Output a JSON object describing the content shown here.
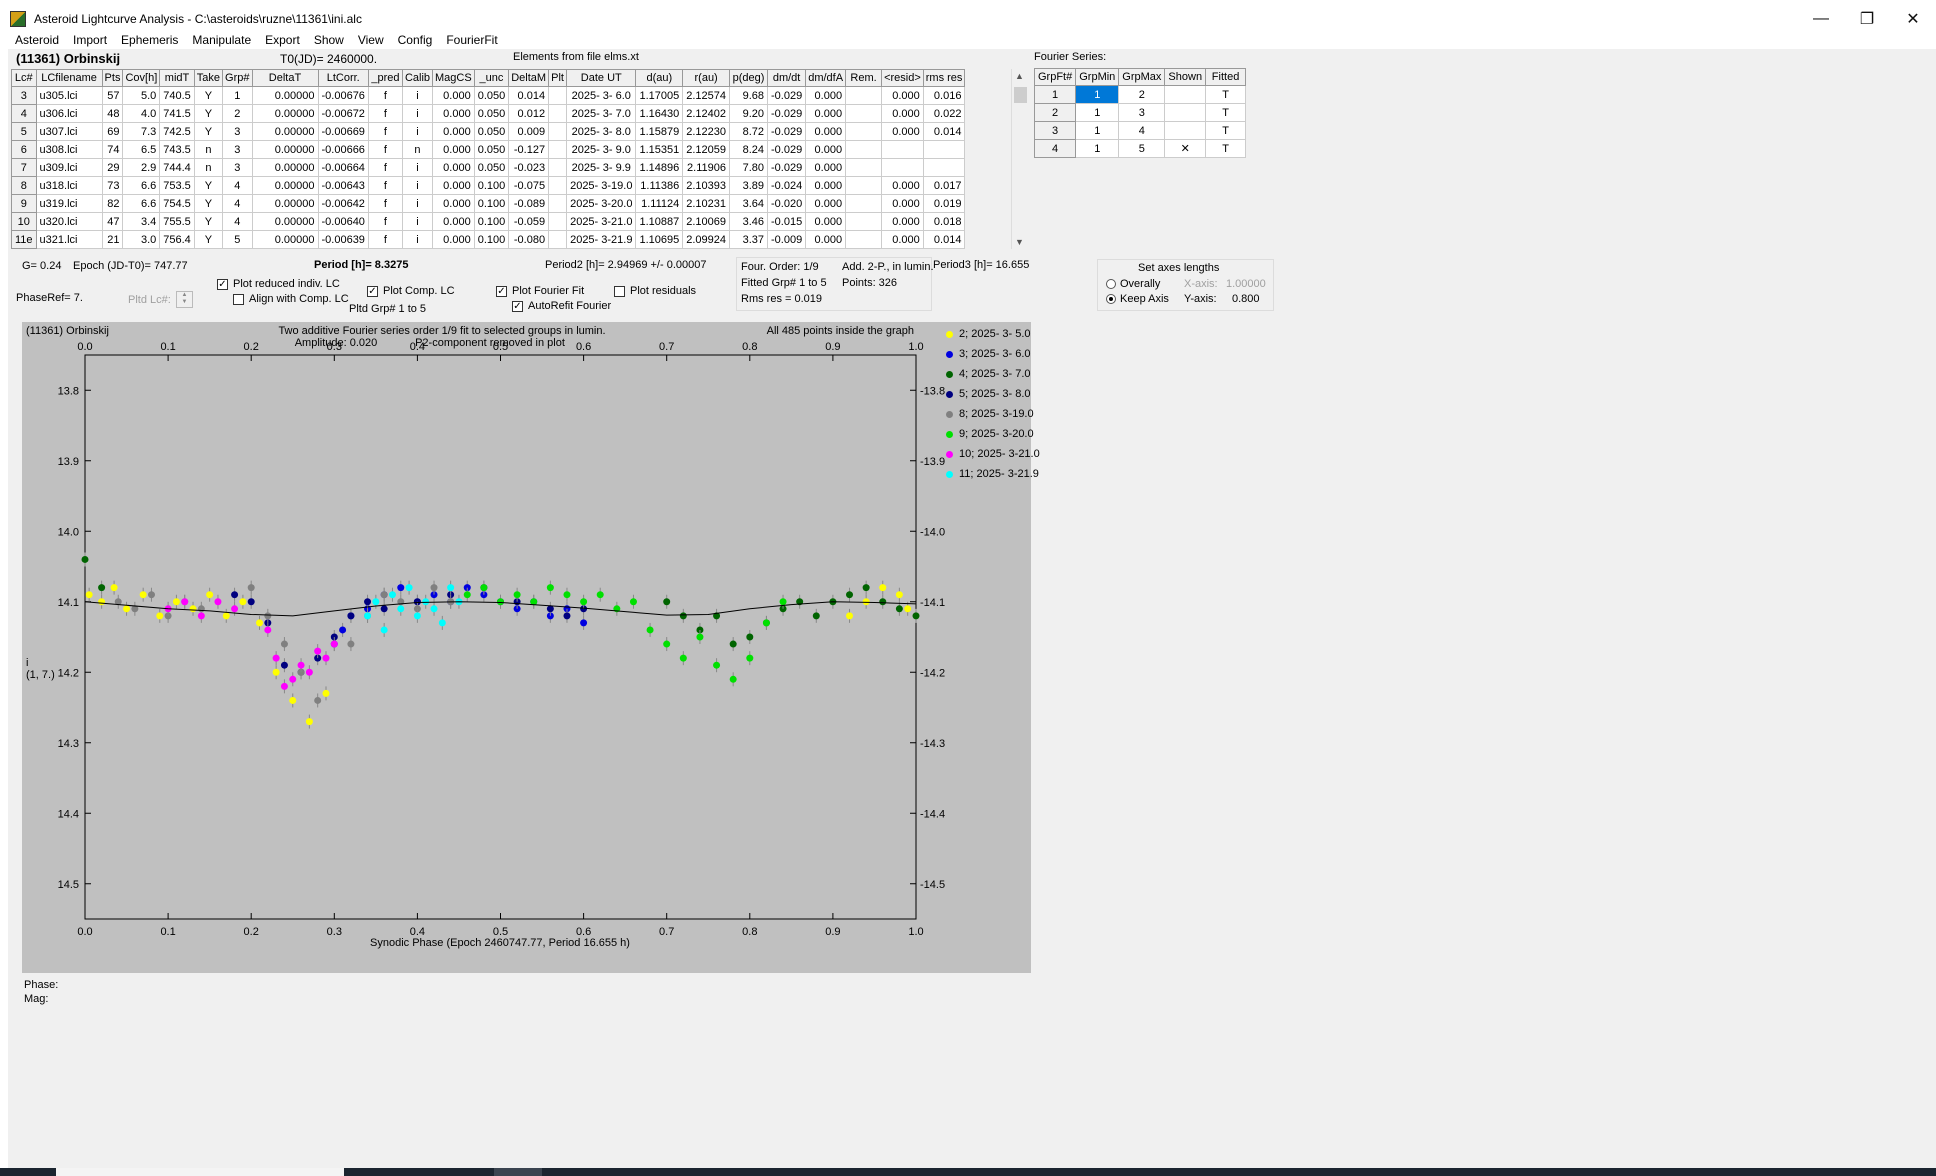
{
  "window": {
    "title": "Asteroid Lightcurve Analysis - C:\\asteroids\\ruzne\\11361\\ini.alc",
    "minimize": "—",
    "maximize": "❐",
    "close": "✕"
  },
  "menu": [
    "Asteroid",
    "Import",
    "Ephemeris",
    "Manipulate",
    "Export",
    "Show",
    "View",
    "Config",
    "FourierFit"
  ],
  "header": {
    "asteroid": "(11361) Orbinskij",
    "t0": "T0(JD)= 2460000.",
    "elements": "Elements from file elms.xt"
  },
  "lc_table": {
    "columns": [
      "Lc#",
      "LCfilename",
      "Pts",
      "Cov[h]",
      "midT",
      "Take",
      "Grp#",
      "DeltaT",
      "LtCorr.",
      "_pred",
      "Calib",
      "MagCS",
      "_unc",
      "DeltaM",
      "Plt",
      "Date UT",
      "d(au)",
      "r(au)",
      "p(deg)",
      "dm/dt",
      "dm/dfA",
      "Rem.",
      "<resid>",
      "rms res"
    ],
    "rows": [
      [
        "3",
        "u305.lci",
        "57",
        "5.0",
        "740.5",
        "Y",
        "1",
        "0.00000",
        "-0.00676",
        "f",
        "i",
        "0.000",
        "0.050",
        "0.014",
        "",
        "2025- 3- 6.0",
        "1.17005",
        "2.12574",
        "9.68",
        "-0.029",
        "0.000",
        "",
        "0.000",
        "0.016"
      ],
      [
        "4",
        "u306.lci",
        "48",
        "4.0",
        "741.5",
        "Y",
        "2",
        "0.00000",
        "-0.00672",
        "f",
        "i",
        "0.000",
        "0.050",
        "0.012",
        "",
        "2025- 3- 7.0",
        "1.16430",
        "2.12402",
        "9.20",
        "-0.029",
        "0.000",
        "",
        "0.000",
        "0.022"
      ],
      [
        "5",
        "u307.lci",
        "69",
        "7.3",
        "742.5",
        "Y",
        "3",
        "0.00000",
        "-0.00669",
        "f",
        "i",
        "0.000",
        "0.050",
        "0.009",
        "",
        "2025- 3- 8.0",
        "1.15879",
        "2.12230",
        "8.72",
        "-0.029",
        "0.000",
        "",
        "0.000",
        "0.014"
      ],
      [
        "6",
        "u308.lci",
        "74",
        "6.5",
        "743.5",
        "n",
        "3",
        "0.00000",
        "-0.00666",
        "f",
        "n",
        "0.000",
        "0.050",
        "-0.127",
        "",
        "2025- 3- 9.0",
        "1.15351",
        "2.12059",
        "8.24",
        "-0.029",
        "0.000",
        "",
        "",
        ""
      ],
      [
        "7",
        "u309.lci",
        "29",
        "2.9",
        "744.4",
        "n",
        "3",
        "0.00000",
        "-0.00664",
        "f",
        "i",
        "0.000",
        "0.050",
        "-0.023",
        "",
        "2025- 3- 9.9",
        "1.14896",
        "2.11906",
        "7.80",
        "-0.029",
        "0.000",
        "",
        "",
        ""
      ],
      [
        "8",
        "u318.lci",
        "73",
        "6.6",
        "753.5",
        "Y",
        "4",
        "0.00000",
        "-0.00643",
        "f",
        "i",
        "0.000",
        "0.100",
        "-0.075",
        "",
        "2025- 3-19.0",
        "1.11386",
        "2.10393",
        "3.89",
        "-0.024",
        "0.000",
        "",
        "0.000",
        "0.017"
      ],
      [
        "9",
        "u319.lci",
        "82",
        "6.6",
        "754.5",
        "Y",
        "4",
        "0.00000",
        "-0.00642",
        "f",
        "i",
        "0.000",
        "0.100",
        "-0.089",
        "",
        "2025- 3-20.0",
        "1.11124",
        "2.10231",
        "3.64",
        "-0.020",
        "0.000",
        "",
        "0.000",
        "0.019"
      ],
      [
        "10",
        "u320.lci",
        "47",
        "3.4",
        "755.5",
        "Y",
        "4",
        "0.00000",
        "-0.00640",
        "f",
        "i",
        "0.000",
        "0.100",
        "-0.059",
        "",
        "2025- 3-21.0",
        "1.10887",
        "2.10069",
        "3.46",
        "-0.015",
        "0.000",
        "",
        "0.000",
        "0.018"
      ],
      [
        "11e",
        "u321.lci",
        "21",
        "3.0",
        "756.4",
        "Y",
        "5",
        "0.00000",
        "-0.00639",
        "f",
        "i",
        "0.000",
        "0.100",
        "-0.080",
        "",
        "2025- 3-21.9",
        "1.10695",
        "2.09924",
        "3.37",
        "-0.009",
        "0.000",
        "",
        "0.000",
        "0.014"
      ]
    ]
  },
  "fourier": {
    "label": "Fourier Series:",
    "columns": [
      "GrpFt#",
      "GrpMin",
      "GrpMax",
      "Shown",
      "Fitted"
    ],
    "rows": [
      [
        "1",
        "1",
        "2",
        "",
        "T"
      ],
      [
        "2",
        "1",
        "3",
        "",
        "T"
      ],
      [
        "3",
        "1",
        "4",
        "",
        "T"
      ],
      [
        "4",
        "1",
        "5",
        "✕",
        "T"
      ]
    ]
  },
  "controls": {
    "g_value": "G= 0.24",
    "epoch": "Epoch (JD-T0)= 747.77",
    "period": "Period [h]= 8.3275",
    "period2": "Period2 [h]= 2.94969 +/- 0.00007",
    "period3": "Period3 [h]= 16.655",
    "phaseref": "PhaseRef= 7.",
    "pltd_lc": "Pltd Lc#:",
    "plot_reduced": "Plot reduced indiv. LC",
    "align_comp": "Align with Comp. LC",
    "plot_comp": "Plot Comp. LC",
    "pltd_grp": "Pltd Grp#  1   to   5",
    "plot_fourier": "Plot Fourier Fit",
    "autorefit": "AutoRefit Fourier",
    "plot_residuals": "Plot residuals",
    "fit_info": {
      "order": "Four. Order:  1/9",
      "add": "Add. 2-P., in lumin.",
      "fitted": "Fitted Grp# 1 to 5",
      "points": "Points:  326",
      "rms": "Rms res      = 0.019"
    },
    "axes": {
      "title": "Set axes lengths",
      "overally": "Overally",
      "keep": "Keep Axis",
      "xaxis_label": "X-axis:",
      "xaxis_val": "1.00000",
      "yaxis_label": "Y-axis:",
      "yaxis_val": "0.800"
    }
  },
  "graph": {
    "name": "(11361) Orbinskij",
    "subtitle1": "Two additive Fourier series order 1/9 fit to selected groups in lumin.",
    "subtitle2": "Amplitude: 0.020",
    "subtitle3": "P2-component removed in plot",
    "all_points": "All 485 points inside the graph",
    "xlabel": "Synodic Phase (Epoch 2460747.77, Period 16.655 h)",
    "ylabel_1": "i",
    "ylabel_2": "(1, 7.)"
  },
  "chart_data": {
    "type": "scatter",
    "xlabel": "Synodic Phase (Epoch 2460747.77, Period 16.655 h)",
    "ylabel": "i (1, 7.)",
    "xlim": [
      0.0,
      1.0
    ],
    "ylim": [
      14.55,
      13.75
    ],
    "y_inverted": true,
    "x_ticks": [
      "0.0",
      "0.1",
      "0.2",
      "0.3",
      "0.4",
      "0.5",
      "0.6",
      "0.7",
      "0.8",
      "0.9",
      "1.0"
    ],
    "y_ticks": [
      "13.8",
      "13.9",
      "14.0",
      "14.1",
      "14.2",
      "14.3",
      "14.4",
      "14.5"
    ],
    "grid": false,
    "legend_position": "right",
    "fit_curve": {
      "x": [
        0.0,
        0.05,
        0.1,
        0.15,
        0.2,
        0.25,
        0.3,
        0.35,
        0.4,
        0.45,
        0.5,
        0.55,
        0.6,
        0.65,
        0.7,
        0.75,
        0.8,
        0.85,
        0.9,
        0.95,
        1.0
      ],
      "y": [
        14.1,
        14.105,
        14.11,
        14.113,
        14.118,
        14.12,
        14.113,
        14.106,
        14.101,
        14.1,
        14.101,
        14.105,
        14.109,
        14.114,
        14.119,
        14.118,
        14.11,
        14.104,
        14.1,
        14.101,
        14.103
      ]
    },
    "series": [
      {
        "name": "2; 2025- 3- 5.0",
        "color": "#ffff00",
        "x": [
          0.005,
          0.02,
          0.035,
          0.05,
          0.07,
          0.09,
          0.11,
          0.13,
          0.15,
          0.17,
          0.19,
          0.21,
          0.23,
          0.25,
          0.27,
          0.29,
          0.92,
          0.94,
          0.96,
          0.98,
          0.99
        ],
        "y": [
          14.09,
          14.1,
          14.08,
          14.11,
          14.09,
          14.12,
          14.1,
          14.11,
          14.09,
          14.12,
          14.1,
          14.13,
          14.2,
          14.24,
          14.27,
          14.23,
          14.12,
          14.1,
          14.08,
          14.09,
          14.11
        ]
      },
      {
        "name": "3; 2025- 3- 6.0",
        "color": "#0000e0",
        "x": [
          0.3,
          0.31,
          0.32,
          0.34,
          0.36,
          0.38,
          0.4,
          0.42,
          0.44,
          0.46,
          0.48,
          0.5,
          0.52,
          0.54,
          0.56,
          0.58,
          0.6
        ],
        "y": [
          14.16,
          14.14,
          14.12,
          14.11,
          14.09,
          14.08,
          14.1,
          14.09,
          14.1,
          14.08,
          14.09,
          14.1,
          14.11,
          14.1,
          14.12,
          14.11,
          14.13
        ]
      },
      {
        "name": "4; 2025- 3- 7.0",
        "color": "#006400",
        "x": [
          0.0,
          0.02,
          0.7,
          0.72,
          0.74,
          0.76,
          0.78,
          0.8,
          0.82,
          0.84,
          0.86,
          0.88,
          0.9,
          0.92,
          0.94,
          0.96,
          0.98,
          1.0
        ],
        "y": [
          14.04,
          14.08,
          14.1,
          14.12,
          14.14,
          14.12,
          14.16,
          14.15,
          14.13,
          14.11,
          14.1,
          14.12,
          14.1,
          14.09,
          14.08,
          14.1,
          14.11,
          14.12
        ]
      },
      {
        "name": "5; 2025- 3- 8.0",
        "color": "#000080",
        "x": [
          0.18,
          0.2,
          0.22,
          0.24,
          0.26,
          0.28,
          0.3,
          0.32,
          0.34,
          0.36,
          0.4,
          0.44,
          0.48,
          0.52,
          0.56,
          0.58,
          0.6
        ],
        "y": [
          14.09,
          14.1,
          14.13,
          14.19,
          14.2,
          14.18,
          14.15,
          14.12,
          14.1,
          14.11,
          14.1,
          14.09,
          14.08,
          14.1,
          14.11,
          14.12,
          14.11
        ]
      },
      {
        "name": "8; 2025- 3-19.0",
        "color": "#808080",
        "x": [
          0.04,
          0.06,
          0.08,
          0.1,
          0.12,
          0.14,
          0.2,
          0.22,
          0.24,
          0.26,
          0.28,
          0.32,
          0.34,
          0.36,
          0.38,
          0.4,
          0.42,
          0.44
        ],
        "y": [
          14.1,
          14.11,
          14.09,
          14.12,
          14.1,
          14.11,
          14.08,
          14.12,
          14.16,
          14.2,
          14.24,
          14.16,
          14.12,
          14.09,
          14.1,
          14.11,
          14.08,
          14.1
        ]
      },
      {
        "name": "9; 2025- 3-20.0",
        "color": "#00e000",
        "x": [
          0.46,
          0.48,
          0.5,
          0.52,
          0.54,
          0.56,
          0.58,
          0.6,
          0.62,
          0.64,
          0.66,
          0.68,
          0.7,
          0.72,
          0.74,
          0.76,
          0.78,
          0.8,
          0.82,
          0.84
        ],
        "y": [
          14.09,
          14.08,
          14.1,
          14.09,
          14.1,
          14.08,
          14.09,
          14.1,
          14.09,
          14.11,
          14.1,
          14.14,
          14.16,
          14.18,
          14.15,
          14.19,
          14.21,
          14.18,
          14.13,
          14.1
        ]
      },
      {
        "name": "10; 2025- 3-21.0",
        "color": "#ff00ff",
        "x": [
          0.1,
          0.12,
          0.14,
          0.16,
          0.18,
          0.22,
          0.23,
          0.24,
          0.25,
          0.26,
          0.27,
          0.28,
          0.29,
          0.3
        ],
        "y": [
          14.11,
          14.1,
          14.12,
          14.1,
          14.11,
          14.14,
          14.18,
          14.22,
          14.21,
          14.19,
          14.2,
          14.17,
          14.18,
          14.16
        ]
      },
      {
        "name": "11; 2025- 3-21.9",
        "color": "#00ffff",
        "x": [
          0.34,
          0.35,
          0.36,
          0.37,
          0.38,
          0.39,
          0.4,
          0.41,
          0.42,
          0.43,
          0.44,
          0.45
        ],
        "y": [
          14.12,
          14.1,
          14.14,
          14.09,
          14.11,
          14.08,
          14.12,
          14.1,
          14.11,
          14.13,
          14.08,
          14.1
        ]
      }
    ]
  }
}
